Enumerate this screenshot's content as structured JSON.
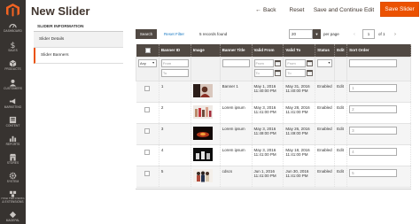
{
  "page": {
    "title": "New Slider"
  },
  "header": {
    "back_label": "Back",
    "reset_label": "Reset",
    "save_continue_label": "Save and Continue Edit",
    "save_label": "Save Slider"
  },
  "admin_nav": [
    {
      "label": "DASHBOARD",
      "icon": "dashboard-icon"
    },
    {
      "label": "SALES",
      "icon": "dollar-icon"
    },
    {
      "label": "PRODUCTS",
      "icon": "box-icon"
    },
    {
      "label": "CUSTOMERS",
      "icon": "customer-icon"
    },
    {
      "label": "MARKETING",
      "icon": "megaphone-icon"
    },
    {
      "label": "CONTENT",
      "icon": "content-icon"
    },
    {
      "label": "REPORTS",
      "icon": "bar-chart-icon"
    },
    {
      "label": "STORES",
      "icon": "store-icon"
    },
    {
      "label": "SYSTEM",
      "icon": "gear-icon"
    },
    {
      "label": "FIND PARTNERS & EXTENSIONS",
      "icon": "partners-icon"
    },
    {
      "label": "MAGEPAL",
      "icon": "magepal-icon"
    }
  ],
  "tabs": {
    "title": "Slider Information",
    "items": [
      {
        "label": "Slider Details"
      },
      {
        "label": "Slider Banners"
      }
    ]
  },
  "toolbar": {
    "search_label": "Search",
    "reset_filter_label": "Reset Filter",
    "records_found": "5 records found",
    "per_page_value": "20",
    "per_page_label": "per page",
    "page_prev": "‹",
    "page_value": "1",
    "page_of": "of 1",
    "page_next": "›"
  },
  "grid": {
    "columns": [
      "Banner ID",
      "Image",
      "Banner Title",
      "Valid From",
      "Valid To",
      "Status",
      "Edit",
      "Sort Order"
    ],
    "filters": {
      "checkbox_select": "Any",
      "banner_id_from": "From",
      "banner_id_to": "To",
      "valid_from_from": "From",
      "valid_from_to": "To",
      "valid_to_from": "From",
      "valid_to_to": "To"
    },
    "rows": [
      {
        "id": "1",
        "title": "Banner 1",
        "valid_from": "May 1, 2016 11:40:00 PM",
        "valid_to": "May 31, 2016 11:40:00 PM",
        "status": "Enabled",
        "edit": "Edit",
        "sort": "1"
      },
      {
        "id": "2",
        "title": "Lorem ipsum",
        "valid_from": "May 3, 2016 11:41:00 PM",
        "valid_to": "May 28, 2016 11:41:00 PM",
        "status": "Enabled",
        "edit": "Edit",
        "sort": "2"
      },
      {
        "id": "3",
        "title": "Lorem ipsum",
        "valid_from": "May 3, 2016 11:49:00 PM",
        "valid_to": "May 26, 2016 11:49:00 PM",
        "status": "Enabled",
        "edit": "Edit",
        "sort": "3"
      },
      {
        "id": "4",
        "title": "Lorem ipsum",
        "valid_from": "May 3, 2016 11:41:00 PM",
        "valid_to": "May 18, 2016 11:41:00 PM",
        "status": "Enabled",
        "edit": "Edit",
        "sort": "4"
      },
      {
        "id": "5",
        "title": "cdscs",
        "valid_from": "Jun 1, 2016 11:41:00 PM",
        "valid_to": "Jun 30, 2016 11:41:00 PM",
        "status": "Enabled",
        "edit": "Edit",
        "sort": "5"
      }
    ]
  },
  "colors": {
    "accent": "#eb5202",
    "nav_bg": "#373330",
    "grid_header": "#514943",
    "link": "#1979c3"
  }
}
